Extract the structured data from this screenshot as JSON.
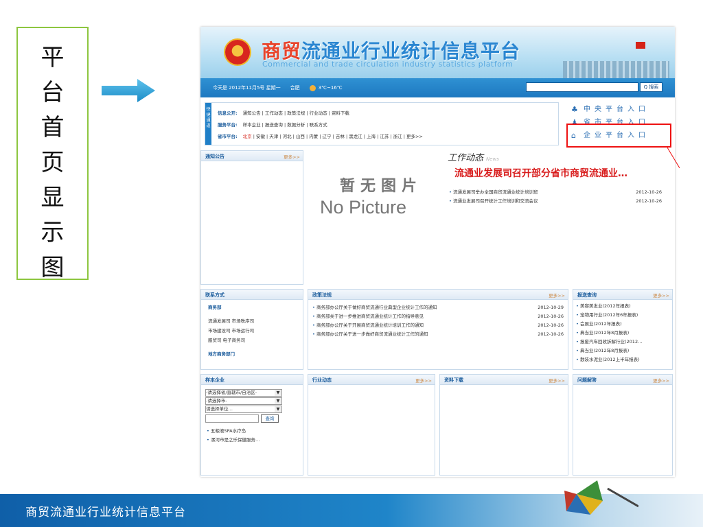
{
  "slide": {
    "vertical_label": "平台首页显示图",
    "footer": "商贸流通业行业统计信息平台"
  },
  "site": {
    "title_part1": "商贸",
    "title_part2": "流通业行业统计信息平台",
    "title_en": "Commercial and trade circulation industry statistics platform",
    "date_text": "今天是 2012年11月5号 星期一",
    "city": "合肥",
    "weather": "3℃~16℃",
    "search_btn": "Q 搜索",
    "quick_tag": "快捷通道",
    "quick_rows": [
      {
        "label": "信息公开:",
        "items": "通知公告 | 工作动态 | 政策法规 | 行业动态 | 资料下载"
      },
      {
        "label": "服务平台:",
        "items": "样本企业 | 报送查询 | 数据分析 | 联系方式"
      },
      {
        "label": "省市平台:",
        "first": "北京",
        "items": "| 安徽 | 天津 | 河北 | 山西 | 内蒙 | 辽宁 | 吉林 | 黑龙江 | 上海 | 江苏 | 浙江 | 更多>>"
      }
    ],
    "platforms": [
      "中央平台入口",
      "省市平台入口",
      "企业平台入口"
    ],
    "notice": {
      "title": "通知公告",
      "more": "更多>>"
    },
    "nopic_cn": "暂无图片",
    "nopic_en": "No Picture",
    "work": {
      "title": "工作动态",
      "sub": "News",
      "headline": "流通业发展司召开部分省市商贸流通业…",
      "items": [
        {
          "t": "流通发展司举办全国商贸流通业统计培训班",
          "d": "2012-10-26"
        },
        {
          "t": "流通业发展司召开统计工作培训和交流会议",
          "d": "2012-10-26"
        }
      ]
    },
    "contact": {
      "title": "联系方式",
      "section": "商务部",
      "lines": [
        "流通发展司    市场秩序司",
        "市场建设司    市场运行司",
        "服贸司        电子商务司"
      ],
      "local": "地方商务部门"
    },
    "policy": {
      "title": "政策法规",
      "more": "更多>>",
      "items": [
        {
          "t": "商务部办公厅关于做好商贸流通行业典型企业统计工作的通知",
          "d": "2012-10-29"
        },
        {
          "t": "商务部关于进一步推进商贸流通业统计工作的指导意见",
          "d": "2012-10-26"
        },
        {
          "t": "商务部办公厅关于开展商贸流通业统计培训工作的通知",
          "d": "2012-10-26"
        },
        {
          "t": "商务部办公厅关于进一步做好商贸流通业统计工作的通知",
          "d": "2012-10-26"
        }
      ]
    },
    "report": {
      "title": "报送查询",
      "more": "更多>>",
      "items": [
        "美容美发业(2012年报表)",
        "宠物用行业(2012年6年报表)",
        "会展业(2012年报表)",
        "典当业(2012年8月报表)",
        "报废汽车回收拆解行业(2012…",
        "典当业(2012年8月报表)",
        "散装水泥业(2012上半年报表)"
      ]
    },
    "sample": {
      "title": "样本企业",
      "sel1": "-请选择省/直辖市/自治区-",
      "sel2": "-请选择市-",
      "sel3": "请选择单位…",
      "query": "查询",
      "items": [
        "五粮液SPA水疗岛",
        "漯河市是之乐保健服务…"
      ]
    },
    "industry": {
      "title": "行业动态",
      "more": "更多>>"
    },
    "download": {
      "title": "资料下载",
      "more": "更多>>"
    },
    "faq": {
      "title": "问题解答",
      "more": "更多>>"
    }
  },
  "colors": {
    "accent": "#1f7fc7",
    "highlight": "#e11111",
    "frame": "#8dc63f"
  }
}
